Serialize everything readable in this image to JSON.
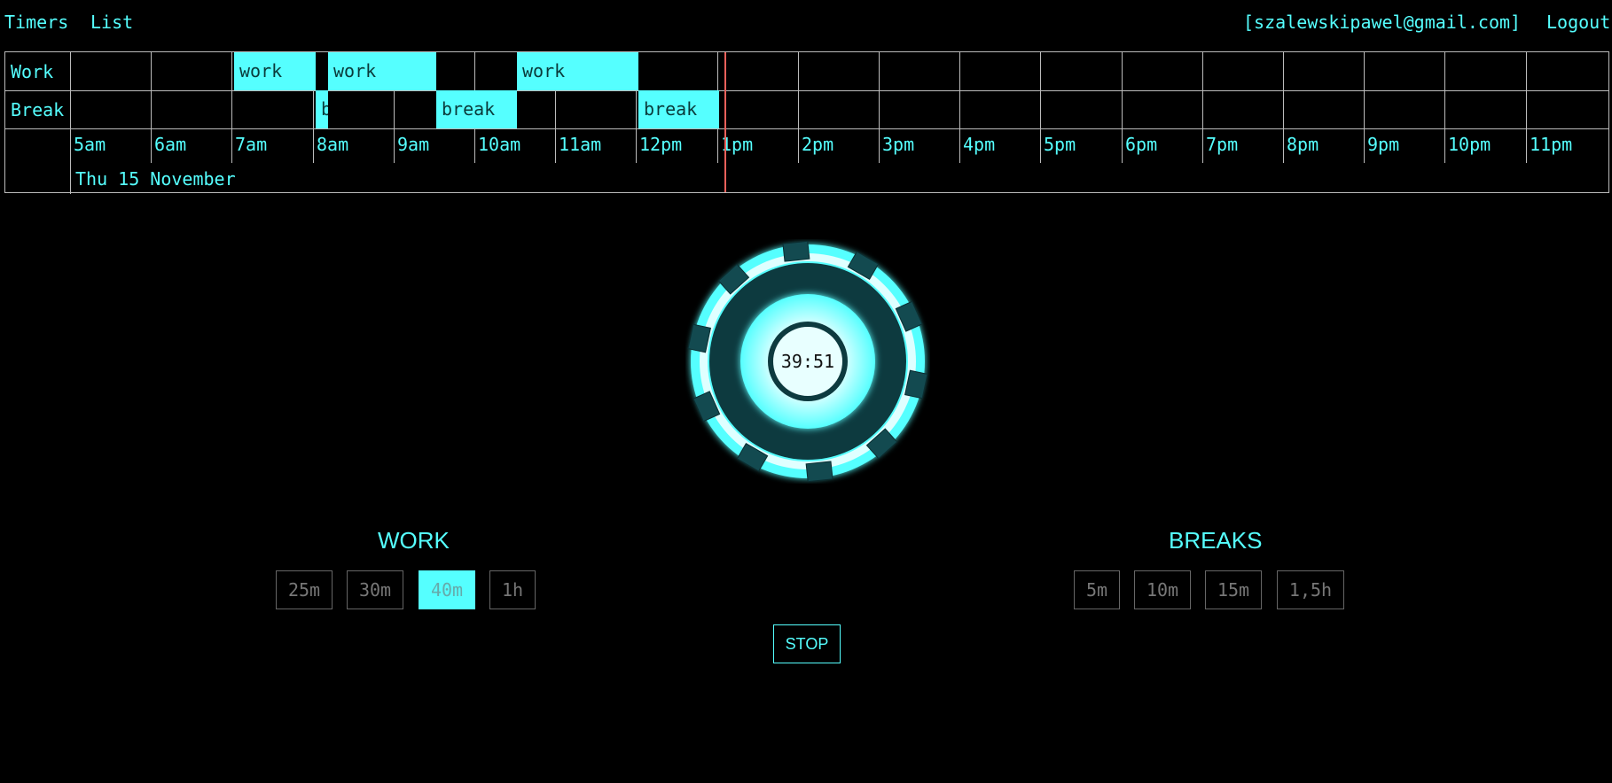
{
  "nav": {
    "timers": "Timers",
    "list": "List",
    "user": "[szalewskipawel@gmail.com]",
    "logout": "Logout"
  },
  "timeline": {
    "rows": [
      "Work",
      "Break"
    ],
    "hours": [
      "5am",
      "6am",
      "7am",
      "8am",
      "9am",
      "10am",
      "11am",
      "12pm",
      "1pm",
      "2pm",
      "3pm",
      "4pm",
      "5pm",
      "6pm",
      "7pm",
      "8pm",
      "9pm",
      "10pm",
      "11pm"
    ],
    "date": "Thu 15 November",
    "work_blocks": [
      "work",
      "work",
      "work"
    ],
    "break_blocks": [
      "b",
      "break",
      "break"
    ]
  },
  "timer": {
    "display": "39:51"
  },
  "work": {
    "title": "WORK",
    "options": [
      "25m",
      "30m",
      "40m",
      "1h"
    ],
    "selected": "40m"
  },
  "breaks": {
    "title": "BREAKS",
    "options": [
      "5m",
      "10m",
      "15m",
      "1,5h"
    ]
  },
  "stop": "STOP",
  "colors": {
    "accent": "#55ffff",
    "now_line": "#e8605a",
    "background": "#000000"
  }
}
